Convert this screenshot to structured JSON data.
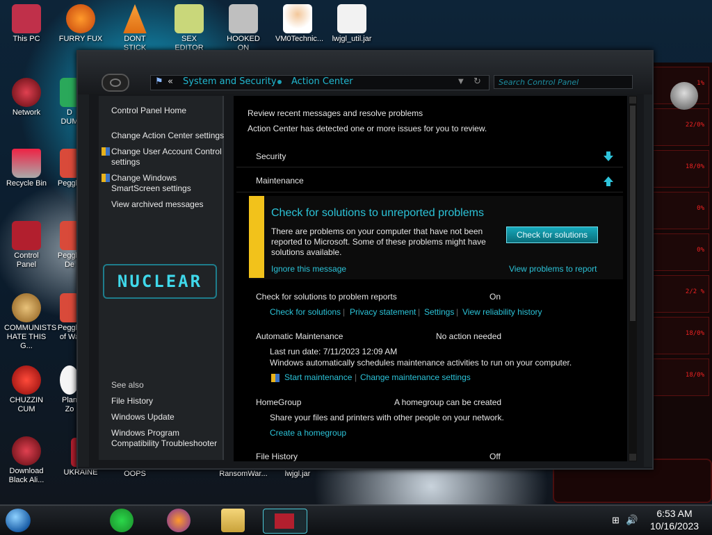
{
  "desktop": {
    "icons": [
      {
        "label": "This PC",
        "icon": "computer-icon",
        "color": "#c0304a"
      },
      {
        "label": "FURRY FUX",
        "icon": "firefox-icon",
        "color": "#ff7a1b"
      },
      {
        "label": "DONT STICK",
        "icon": "vlc-icon",
        "color": "#f07a16"
      },
      {
        "label": "SEX EDITOR",
        "icon": "hxd-icon",
        "color": "#88aa33"
      },
      {
        "label": "HOOKED ON",
        "icon": "app-icon",
        "color": "#bfbfbf"
      },
      {
        "label": "VM0Technic...",
        "icon": "doctor-icon",
        "color": "#e0b58a"
      },
      {
        "label": "lwjgl_util.jar",
        "icon": "java-icon",
        "color": "#e8e8e8"
      },
      {
        "label": "Network",
        "icon": "network-icon",
        "color": "#b21f2e"
      },
      {
        "label": "Recycle Bin",
        "icon": "recycle-bin-icon",
        "color": "#cc3344"
      },
      {
        "label": "Control Panel",
        "icon": "control-panel-icon",
        "color": "#b21f2e"
      },
      {
        "label": "COMMUNISTS HATE THIS G...",
        "icon": "money-bag-icon",
        "color": "#c59a3a"
      },
      {
        "label": "CHUZZIN CUM",
        "icon": "chuzzle-icon",
        "color": "#e03030"
      },
      {
        "label": "Download Black Ali...",
        "icon": "alienware-icon",
        "color": "#b21f2e"
      },
      {
        "label": "D DUM",
        "icon": "app-icon",
        "color": "#2aa85a"
      },
      {
        "label": "Peggle",
        "icon": "peggle-icon",
        "color": "#d94a3a"
      },
      {
        "label": "Peggle De",
        "icon": "peggle-icon",
        "color": "#d94a3a"
      },
      {
        "label": "Peggle of Wa",
        "icon": "peggle-icon",
        "color": "#d94a3a"
      },
      {
        "label": "Plan Zo",
        "icon": "flower-icon",
        "color": "#f5f5f5"
      },
      {
        "label": "UKRAINE",
        "icon": "app-icon",
        "color": "#b21f2e"
      },
      {
        "label": "OOPS",
        "icon": "app-icon",
        "color": "#444444"
      },
      {
        "label": "",
        "icon": "app-icon",
        "color": "#444444"
      },
      {
        "label": "RansomWar...",
        "icon": "app-icon",
        "color": "#444444"
      },
      {
        "label": "lwjgl.jar",
        "icon": "java-icon",
        "color": "#e8e8e8"
      }
    ]
  },
  "window": {
    "breadcrumb": {
      "root_arrows": "«",
      "seg1": "System and Security",
      "seg2": "Action Center"
    },
    "search_placeholder": "Search Control Panel",
    "sidebar": {
      "home": "Control Panel Home",
      "links": [
        "Change Action Center settings",
        "Change User Account Control settings",
        "Change Windows SmartScreen settings",
        "View archived messages"
      ],
      "logo_text": "NUCLEAR",
      "see_also_title": "See also",
      "see_also": [
        "File History",
        "Windows Update",
        "Windows Program Compatibility Troubleshooter"
      ]
    },
    "content": {
      "heading": "Review recent messages and resolve problems",
      "subheading": "Action Center has detected one or more issues for you to review.",
      "security_title": "Security",
      "maintenance_title": "Maintenance",
      "alert": {
        "title": "Check for solutions to unreported problems",
        "body": "There are problems on your computer that have not been reported to Microsoft. Some of these problems might have solutions available.",
        "button": "Check for solutions",
        "ignore": "Ignore this message",
        "view": "View problems to report"
      },
      "cfs_reports": {
        "label": "Check for solutions to problem reports",
        "status": "On",
        "links": [
          "Check for solutions",
          "Privacy statement",
          "Settings",
          "View reliability history"
        ]
      },
      "auto_maint": {
        "label": "Automatic Maintenance",
        "status": "No action needed",
        "last_run": "Last run date: 7/11/2023 12:09 AM",
        "desc": "Windows automatically schedules maintenance activities to run on your computer.",
        "start": "Start maintenance",
        "change": "Change maintenance settings"
      },
      "homegroup": {
        "label": "HomeGroup",
        "status": "A homegroup can be created",
        "desc": "Share your files and printers with other people on your network.",
        "create": "Create a homegroup"
      },
      "file_history": {
        "label": "File History",
        "status": "Off"
      }
    }
  },
  "taskbar": {
    "time": "6:53 AM",
    "date": "10/16/2023",
    "apps": [
      "start-orb",
      "messages-icon",
      "firefox-icon",
      "file-explorer-icon",
      "control-panel-icon"
    ]
  },
  "right_panel_values": [
    "1%",
    "22/0%",
    "18/0%",
    "0%",
    "0%",
    "2/2 %",
    "18/0%",
    "18/0%"
  ]
}
